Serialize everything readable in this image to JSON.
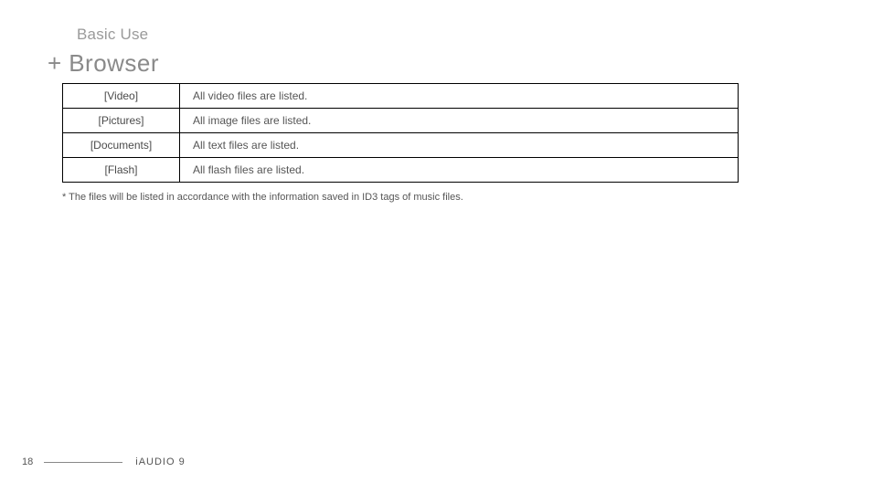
{
  "section_label": "Basic Use",
  "title_prefix": "+",
  "title": "Browser",
  "rows": [
    {
      "category": "[Video]",
      "description": "All video files are listed."
    },
    {
      "category": "[Pictures]",
      "description": "All image files are listed."
    },
    {
      "category": "[Documents]",
      "description": "All text files are listed."
    },
    {
      "category": "[Flash]",
      "description": "All flash files are listed."
    }
  ],
  "footnote": "* The files will be listed in accordance with the information saved in ID3 tags of music files.",
  "page_number": "18",
  "footer_label": "iAUDIO 9"
}
